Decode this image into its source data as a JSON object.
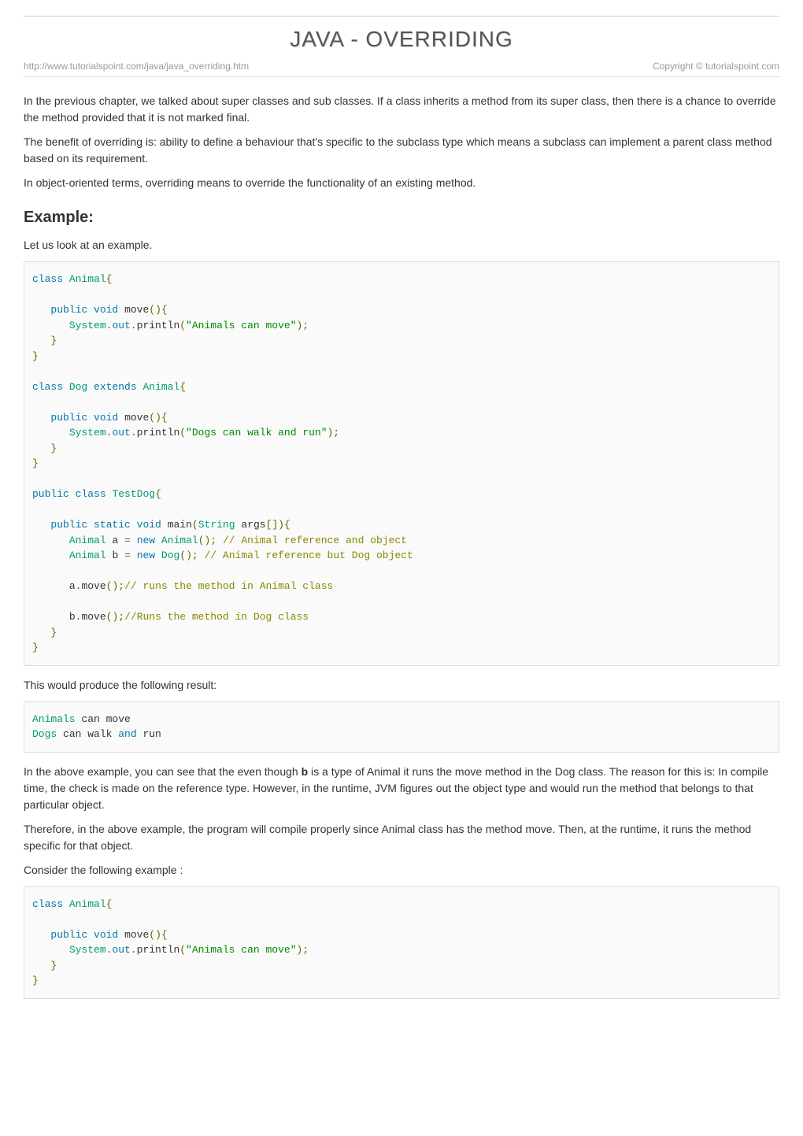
{
  "title": "JAVA - OVERRIDING",
  "url": "http://www.tutorialspoint.com/java/java_overriding.htm",
  "copyright": "Copyright © tutorialspoint.com",
  "paragraphs": {
    "intro1": "In the previous chapter, we talked about super classes and sub classes. If a class inherits a method from its super class, then there is a chance to override the method provided that it is not marked final.",
    "intro2": "The benefit of overriding is: ability to define a behaviour that's specific to the subclass type which means a subclass can implement a parent class method based on its requirement.",
    "intro3": "In object-oriented terms, overriding means to override the functionality of an existing method.",
    "look": "Let us look at an example.",
    "result_label": "This would produce the following result:",
    "explain1_pre": "In the above example, you can see that the even though ",
    "explain1_bold": "b",
    "explain1_post": " is a type of Animal it runs the move method in the Dog class. The reason for this is: In compile time, the check is made on the reference type. However, in the runtime, JVM figures out the object type and would run the method that belongs to that particular object.",
    "explain2": "Therefore, in the above example, the program will compile properly since Animal class has the method move. Then, at the runtime, it runs the method specific for that object.",
    "consider": "Consider the following example :"
  },
  "headings": {
    "example": "Example:"
  },
  "code1": {
    "class_kw": "class",
    "Animal": "Animal",
    "public_kw": "public",
    "void_kw": "void",
    "move": "move",
    "System": "System",
    "out": "out",
    "println": "println",
    "animals_can_move": "\"Animals can move\"",
    "Dog": "Dog",
    "extends_kw": "extends",
    "dogs_can_walk": "\"Dogs can walk and run\"",
    "TestDog": "TestDog",
    "static_kw": "static",
    "main": "main",
    "String": "String",
    "args": "args",
    "new_kw": "new",
    "cmt_animal_ref": "// Animal reference and object",
    "cmt_dog_ref": "// Animal reference but Dog object",
    "cmt_runs_animal": "// runs the method in Animal class",
    "cmt_runs_dog": "//Runs the method in Dog class",
    "a": "a",
    "b": "b"
  },
  "output1": {
    "line1_a": "Animals",
    "line1_b": " can move",
    "line2_a": "Dogs",
    "line2_b": " can walk ",
    "line2_c": "and",
    "line2_d": " run"
  }
}
